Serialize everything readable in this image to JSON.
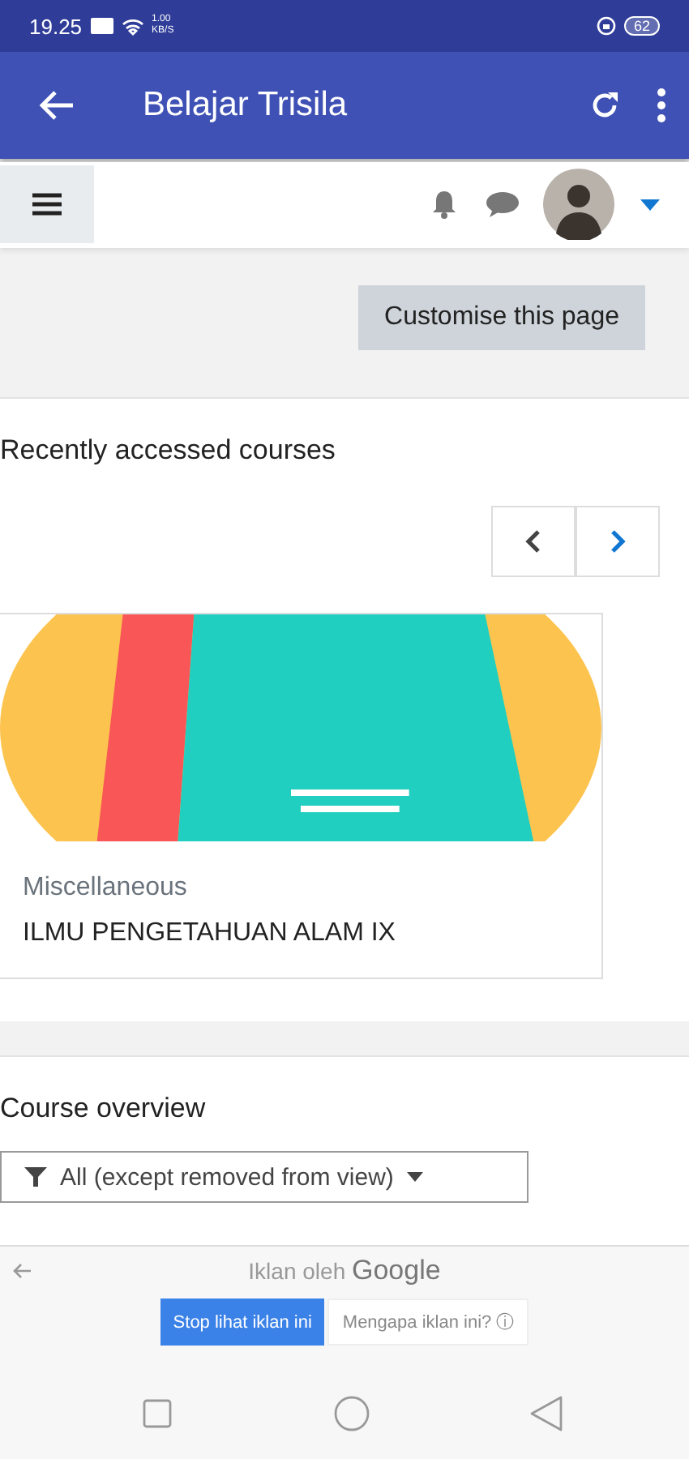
{
  "status_bar": {
    "time": "19.25",
    "speed": "1.00 KB/S",
    "battery": "62"
  },
  "app_bar": {
    "title": "Belajar Trisila"
  },
  "customise_button": "Customise this page",
  "recent": {
    "title": "Recently accessed courses",
    "nav": [
      {
        "kind": "prev",
        "disabled": true
      },
      {
        "kind": "next",
        "disabled": false
      }
    ],
    "courses": [
      {
        "category": "Miscellaneous",
        "name": "ILMU PENGETAHUAN ALAM IX"
      }
    ]
  },
  "overview": {
    "title": "Course overview",
    "filter": "All (except removed from view)"
  },
  "ad": {
    "label": "Iklan oleh",
    "brand": "Google",
    "stop": "Stop lihat iklan ini",
    "why": "Mengapa iklan ini?",
    "info": "ⓘ"
  }
}
